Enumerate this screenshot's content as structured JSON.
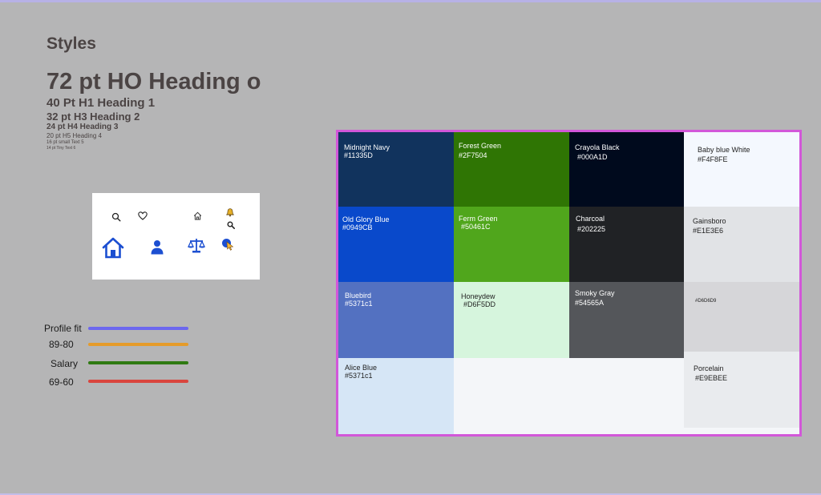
{
  "styles": {
    "title": "Styles",
    "headings": {
      "h0": "72 pt HO Heading o",
      "h1": "40 Pt H1 Heading 1",
      "h3": "32 pt H3 Heading 2",
      "h4": "24 pt H4  Heading 3",
      "h5": "20 pt H5 Heading 4",
      "small": "16 pt small Text  5",
      "tiny": "14 pt Tiny Text 6"
    }
  },
  "icons": [
    "search-icon",
    "heart-icon",
    "home-icon",
    "bell-icon",
    "search-icon",
    "home-icon",
    "user-icon",
    "scale-icon",
    "pointer-icon"
  ],
  "legend": [
    {
      "label": "Profile fit",
      "color": "#6c67ee"
    },
    {
      "label": "89-80",
      "color": "#e59b2a"
    },
    {
      "label": "Salary",
      "color": "#2f7a12"
    },
    {
      "label": "69-60",
      "color": "#d9453e"
    }
  ],
  "palette": {
    "border_color": "#d257d9",
    "swatches": [
      {
        "name": "Midnight Navy",
        "hex": "#11335D",
        "color": "#11335d"
      },
      {
        "name": "Forest Green",
        "hex": "#2F7504",
        "color": "#2f7504"
      },
      {
        "name": "Crayola Black",
        "hex": "#000A1D",
        "color": "#000a1d"
      },
      {
        "name": "Baby blue White",
        "hex": "#F4F8FE",
        "color": "#f4f8fe"
      },
      {
        "name": "Old Glory Blue",
        "hex": "#0949CB",
        "color": "#0949cb"
      },
      {
        "name": "Ferm Green",
        "hex": "#50461C",
        "color": "#50a61c"
      },
      {
        "name": "Charcoal",
        "hex": "#202225",
        "color": "#202225"
      },
      {
        "name": "Gainsboro",
        "hex": "#E1E3E6",
        "color": "#e1e3e6"
      },
      {
        "name": "Bluebird",
        "hex": "#5371c1",
        "color": "#5371c1"
      },
      {
        "name": "Honeydew",
        "hex": "#D6F5DD",
        "color": "#d6f5dd"
      },
      {
        "name": "Smoky Gray",
        "hex": "#54565A",
        "color": "#54565a"
      },
      {
        "name": "",
        "hex": "#D6D6D9",
        "color": "#d6d6d9"
      },
      {
        "name": "Alice Blue",
        "hex": "#5371c1",
        "color": "#d6e6f6"
      },
      {
        "name": "Porcelain",
        "hex": "#E9EBEE",
        "color": "#e9ebee"
      }
    ]
  }
}
